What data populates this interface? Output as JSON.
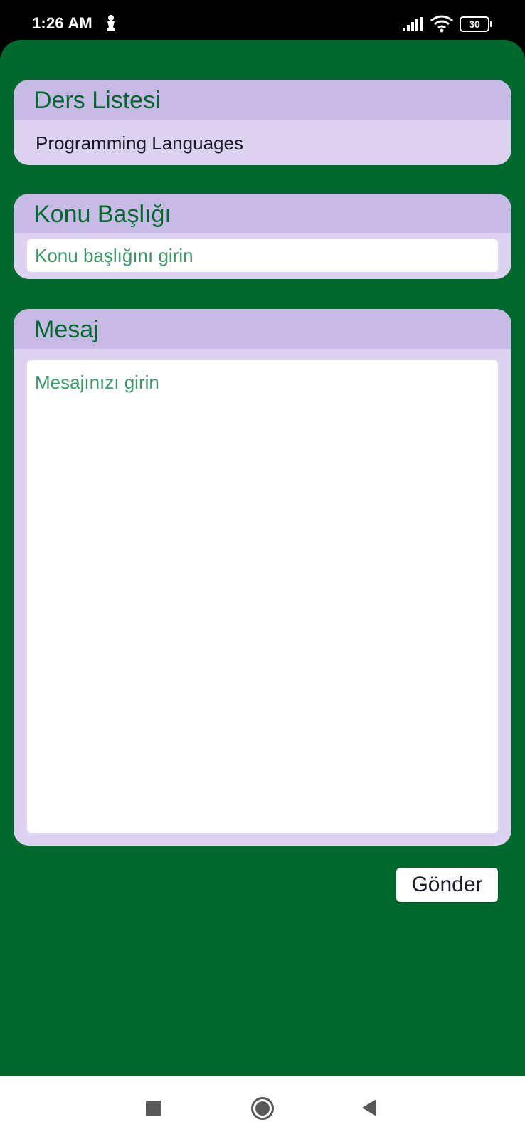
{
  "status_bar": {
    "time": "1:26 AM",
    "battery": "30",
    "icons": [
      "person-icon",
      "signal-icon",
      "wifi-icon",
      "battery-icon"
    ]
  },
  "ders_listesi": {
    "label": "Ders Listesi",
    "selected": "Programming Languages"
  },
  "konu_basligi": {
    "label": "Konu Başlığı",
    "placeholder": "Konu başlığını girin",
    "value": ""
  },
  "mesaj": {
    "label": "Mesaj",
    "placeholder": "Mesajınızı girin",
    "value": ""
  },
  "send_button": {
    "label": "Gönder"
  },
  "nav_bar": {
    "icons": [
      "recents-square-icon",
      "home-circle-icon",
      "back-triangle-icon"
    ]
  },
  "colors": {
    "background": "#00692e",
    "card": "#ddd3f1",
    "card_header": "#c7bae5",
    "label": "#00692e",
    "placeholder": "#3a9a66"
  }
}
